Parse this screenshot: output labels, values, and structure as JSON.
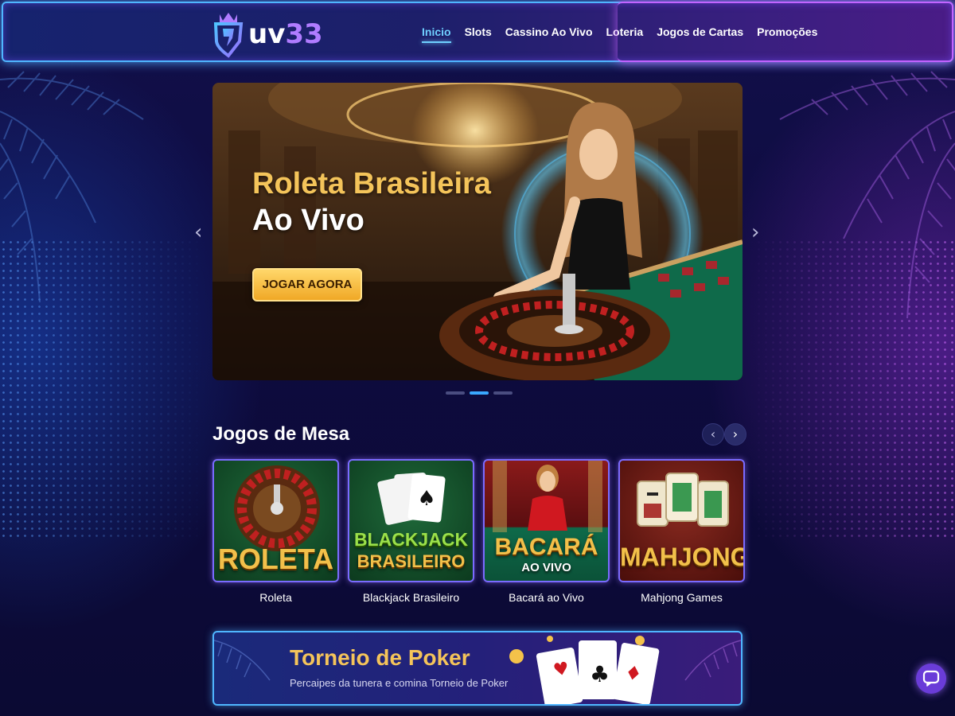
{
  "header": {
    "logo_prefix": "uv",
    "logo_number": "33",
    "nav": [
      {
        "label": "Inicio",
        "active": true
      },
      {
        "label": "Slots",
        "active": false
      },
      {
        "label": "Cassino Ao Vivo",
        "active": false
      },
      {
        "label": "Loteria",
        "active": false
      },
      {
        "label": "Jogos de Cartas",
        "active": false
      },
      {
        "label": "Promoções",
        "active": false
      }
    ]
  },
  "hero": {
    "title_line1": "Roleta Brasileira",
    "title_line2": "Ao Vivo",
    "cta_label": "JOGAR AGORA",
    "slides_total": 3,
    "active_slide": 2
  },
  "section": {
    "title": "Jogos de Mesa",
    "cards": [
      {
        "art_label": "ROLETA",
        "art_sub": "",
        "caption": "Roleta"
      },
      {
        "art_label": "BLACKJACK",
        "art_sub": "BRASILEIRO",
        "caption": "Blackjack Brasileiro"
      },
      {
        "art_label": "BACARÁ",
        "art_sub": "AO VIVO",
        "caption": "Bacará ao Vivo"
      },
      {
        "art_label": "MAHJONG",
        "art_sub": "",
        "caption": "Mahjong Games"
      }
    ]
  },
  "banner": {
    "title": "Torneio de Poker",
    "subtitle": "Percaipes da tunera e comina Torneio de Poker"
  },
  "colors": {
    "accent_blue": "#4fb6ff",
    "accent_purple": "#c264ff",
    "gold": "#f4c45a",
    "nav_active": "#6fd0ff"
  },
  "icons": [
    "crown-shield-logo-icon",
    "chevron-left-icon",
    "chevron-right-icon",
    "chat-bubble-icon"
  ]
}
